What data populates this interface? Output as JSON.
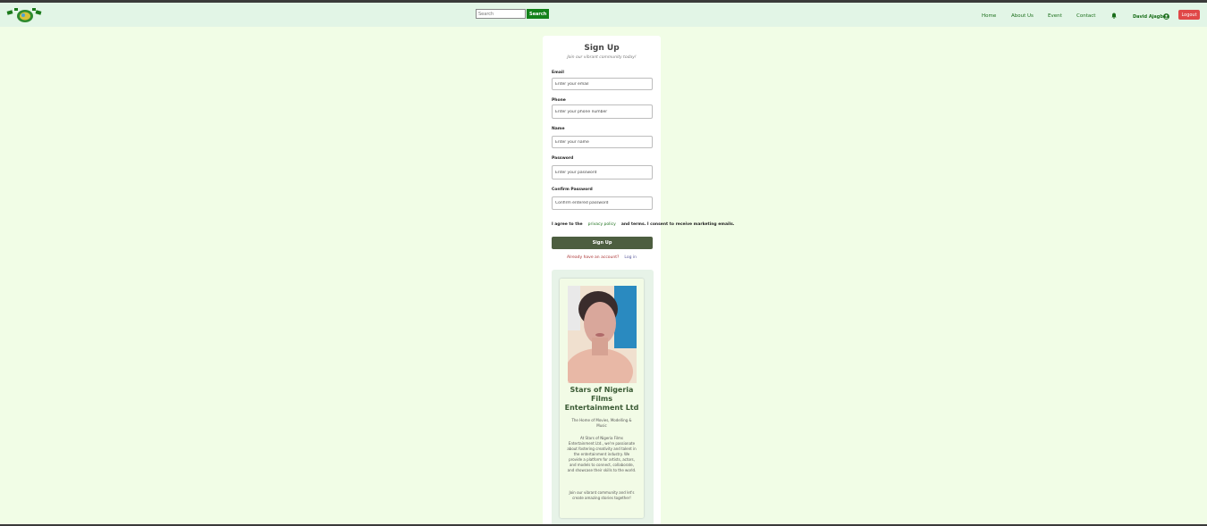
{
  "header": {
    "search": {
      "placeholder": "Search",
      "button_label": "Search"
    },
    "nav": [
      {
        "label": "Home"
      },
      {
        "label": "About Us"
      },
      {
        "label": "Event"
      },
      {
        "label": "Contact"
      }
    ],
    "user_name": "David Ajagbe",
    "logout_label": "Logout",
    "icons": [
      "logo-icon",
      "bell-icon",
      "user-icon"
    ]
  },
  "form": {
    "title": "Sign Up",
    "subtitle": "Join our vibrant community today!",
    "email": {
      "label": "Email",
      "placeholder": "Enter your email"
    },
    "phone": {
      "label": "Phone",
      "placeholder": "Enter your phone number"
    },
    "name": {
      "label": "Name",
      "placeholder": "Enter your name"
    },
    "password": {
      "label": "Password",
      "placeholder": "Enter your password"
    },
    "confirm": {
      "label": "Confirm Password",
      "placeholder": "Confirm entered password"
    },
    "agree": {
      "prefix": "I agree to the",
      "privacy": "privacy policy",
      "suffix": "and terms. I consent to receive marketing emails."
    },
    "submit_label": "Sign Up",
    "already": "Already have an account?",
    "login_link": "Log in"
  },
  "promo": {
    "title": "Stars of Nigeria Films Entertainment Ltd",
    "tagline": "The Home of Movies, Modelling & Music",
    "body": "At Stars of Nigeria Films Entertainment Ltd., we're passionate about fostering creativity and talent in the entertainment industry. We provide a platform for artists, actors, and models to connect, collaborate, and showcase their skills to the world.",
    "join": "Join our vibrant community and let's create amazing stories together!"
  },
  "colors": {
    "page_bg": "#f1fde6",
    "header_bg": "#e2f5e6",
    "accent_green": "#13821a",
    "submit_bg": "#4d5e40",
    "logout_bg": "#e04848"
  }
}
